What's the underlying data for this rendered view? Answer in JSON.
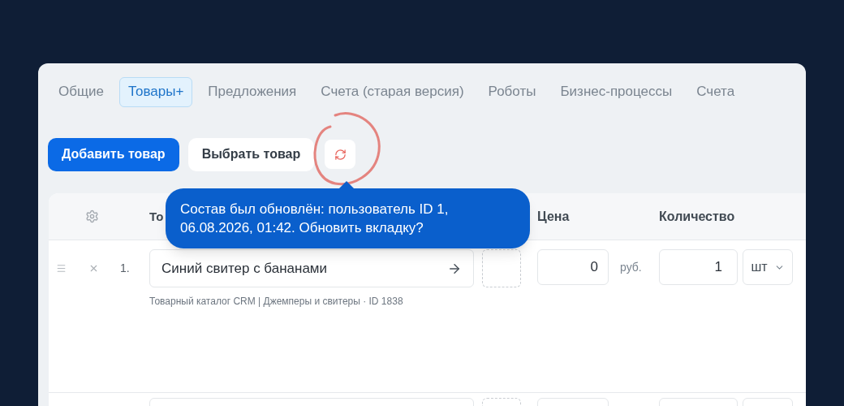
{
  "tabs": [
    {
      "label": "Общие",
      "selected": false
    },
    {
      "label": "Товары+",
      "selected": true
    },
    {
      "label": "Предложения",
      "selected": false
    },
    {
      "label": "Счета (старая версия)",
      "selected": false
    },
    {
      "label": "Роботы",
      "selected": false
    },
    {
      "label": "Бизнес-процессы",
      "selected": false
    },
    {
      "label": "Счета",
      "selected": false
    }
  ],
  "toolbar": {
    "add_button": "Добавить товар",
    "select_button": "Выбрать товар"
  },
  "tooltip": {
    "text": "Состав был обновлён: пользователь ID 1, 06.08.2026, 01:42. Обновить вкладку?"
  },
  "table": {
    "columns": [
      "То",
      "Цена",
      "Количество"
    ],
    "rows": [
      {
        "number": "1.",
        "product": "Синий свитер с бананами",
        "caption": "Товарный каталог CRM | Джемперы и свитеры · ID 1838",
        "price": "0",
        "currency": "руб.",
        "quantity": "1",
        "unit": "шт"
      }
    ]
  }
}
